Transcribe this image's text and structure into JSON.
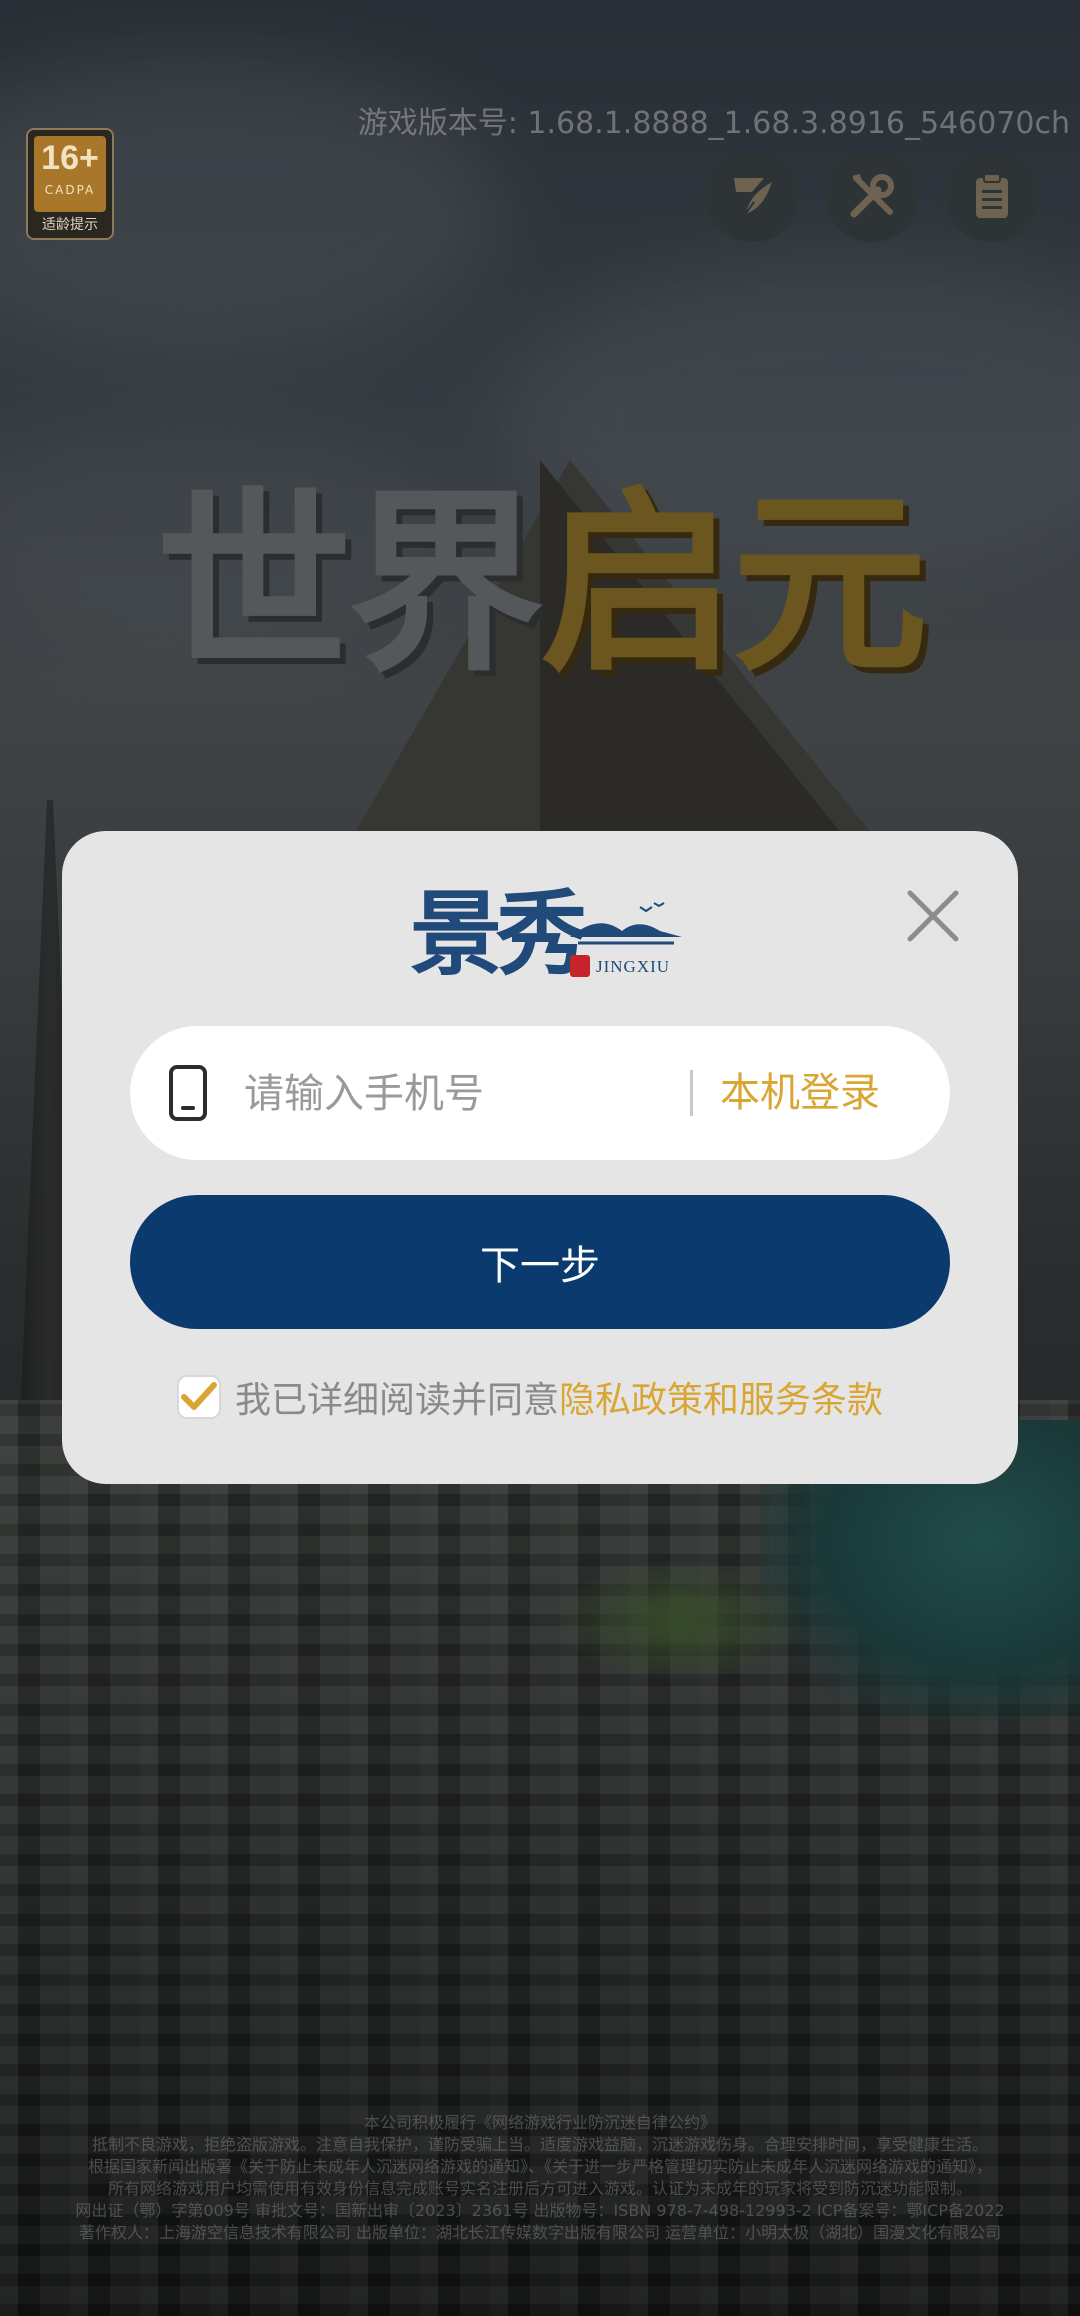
{
  "status": {
    "age_rating": "16+",
    "age_org": "CADPA",
    "age_tip": "适龄提示",
    "version": "游戏版本号: 1.68.1.8888_1.68.3.8916_546070ch"
  },
  "toolbar": {
    "buttons": [
      {
        "icon": "quill-icon"
      },
      {
        "icon": "tools-icon"
      },
      {
        "icon": "notice-icon"
      }
    ]
  },
  "game": {
    "title_part1": "世界",
    "title_part2": "启元"
  },
  "dialog": {
    "logo_text": "景秀",
    "logo_sub": "JINGXIU",
    "phone_placeholder": "请输入手机号",
    "phone_value": "",
    "local_login_label": "本机登录",
    "next_label": "下一步",
    "agree_checked": true,
    "agree_text": "我已详细阅读并同意",
    "agree_link": "隐私政策和服务条款"
  },
  "footer": {
    "lines": [
      "本公司积极履行《网络游戏行业防沉迷自律公约》",
      "抵制不良游戏，拒绝盗版游戏。注意自我保护，谨防受骗上当。适度游戏益脑，沉迷游戏伤身。合理安排时间，享受健康生活。",
      "根据国家新闻出版署《关于防止未成年人沉迷网络游戏的通知》、《关于进一步严格管理切实防止未成年人沉迷网络游戏的通知》，",
      "所有网络游戏用户均需使用有效身份信息完成账号实名注册后方可进入游戏。认证为未成年的玩家将受到防沉迷功能限制。",
      "网出证（鄂）字第009号 审批文号：国新出审〔2023〕2361号 出版物号：ISBN 978-7-498-12993-2 ICP备案号：鄂ICP备2022",
      "著作权人：上海游空信息技术有限公司 出版单位：湖北长江传媒数字出版有限公司 运营单位：小明太极（湖北）国漫文化有限公司"
    ]
  },
  "colors": {
    "primary": "#0a3a6e",
    "accent": "#d9a634",
    "dialog_bg": "#e5e5e6"
  }
}
